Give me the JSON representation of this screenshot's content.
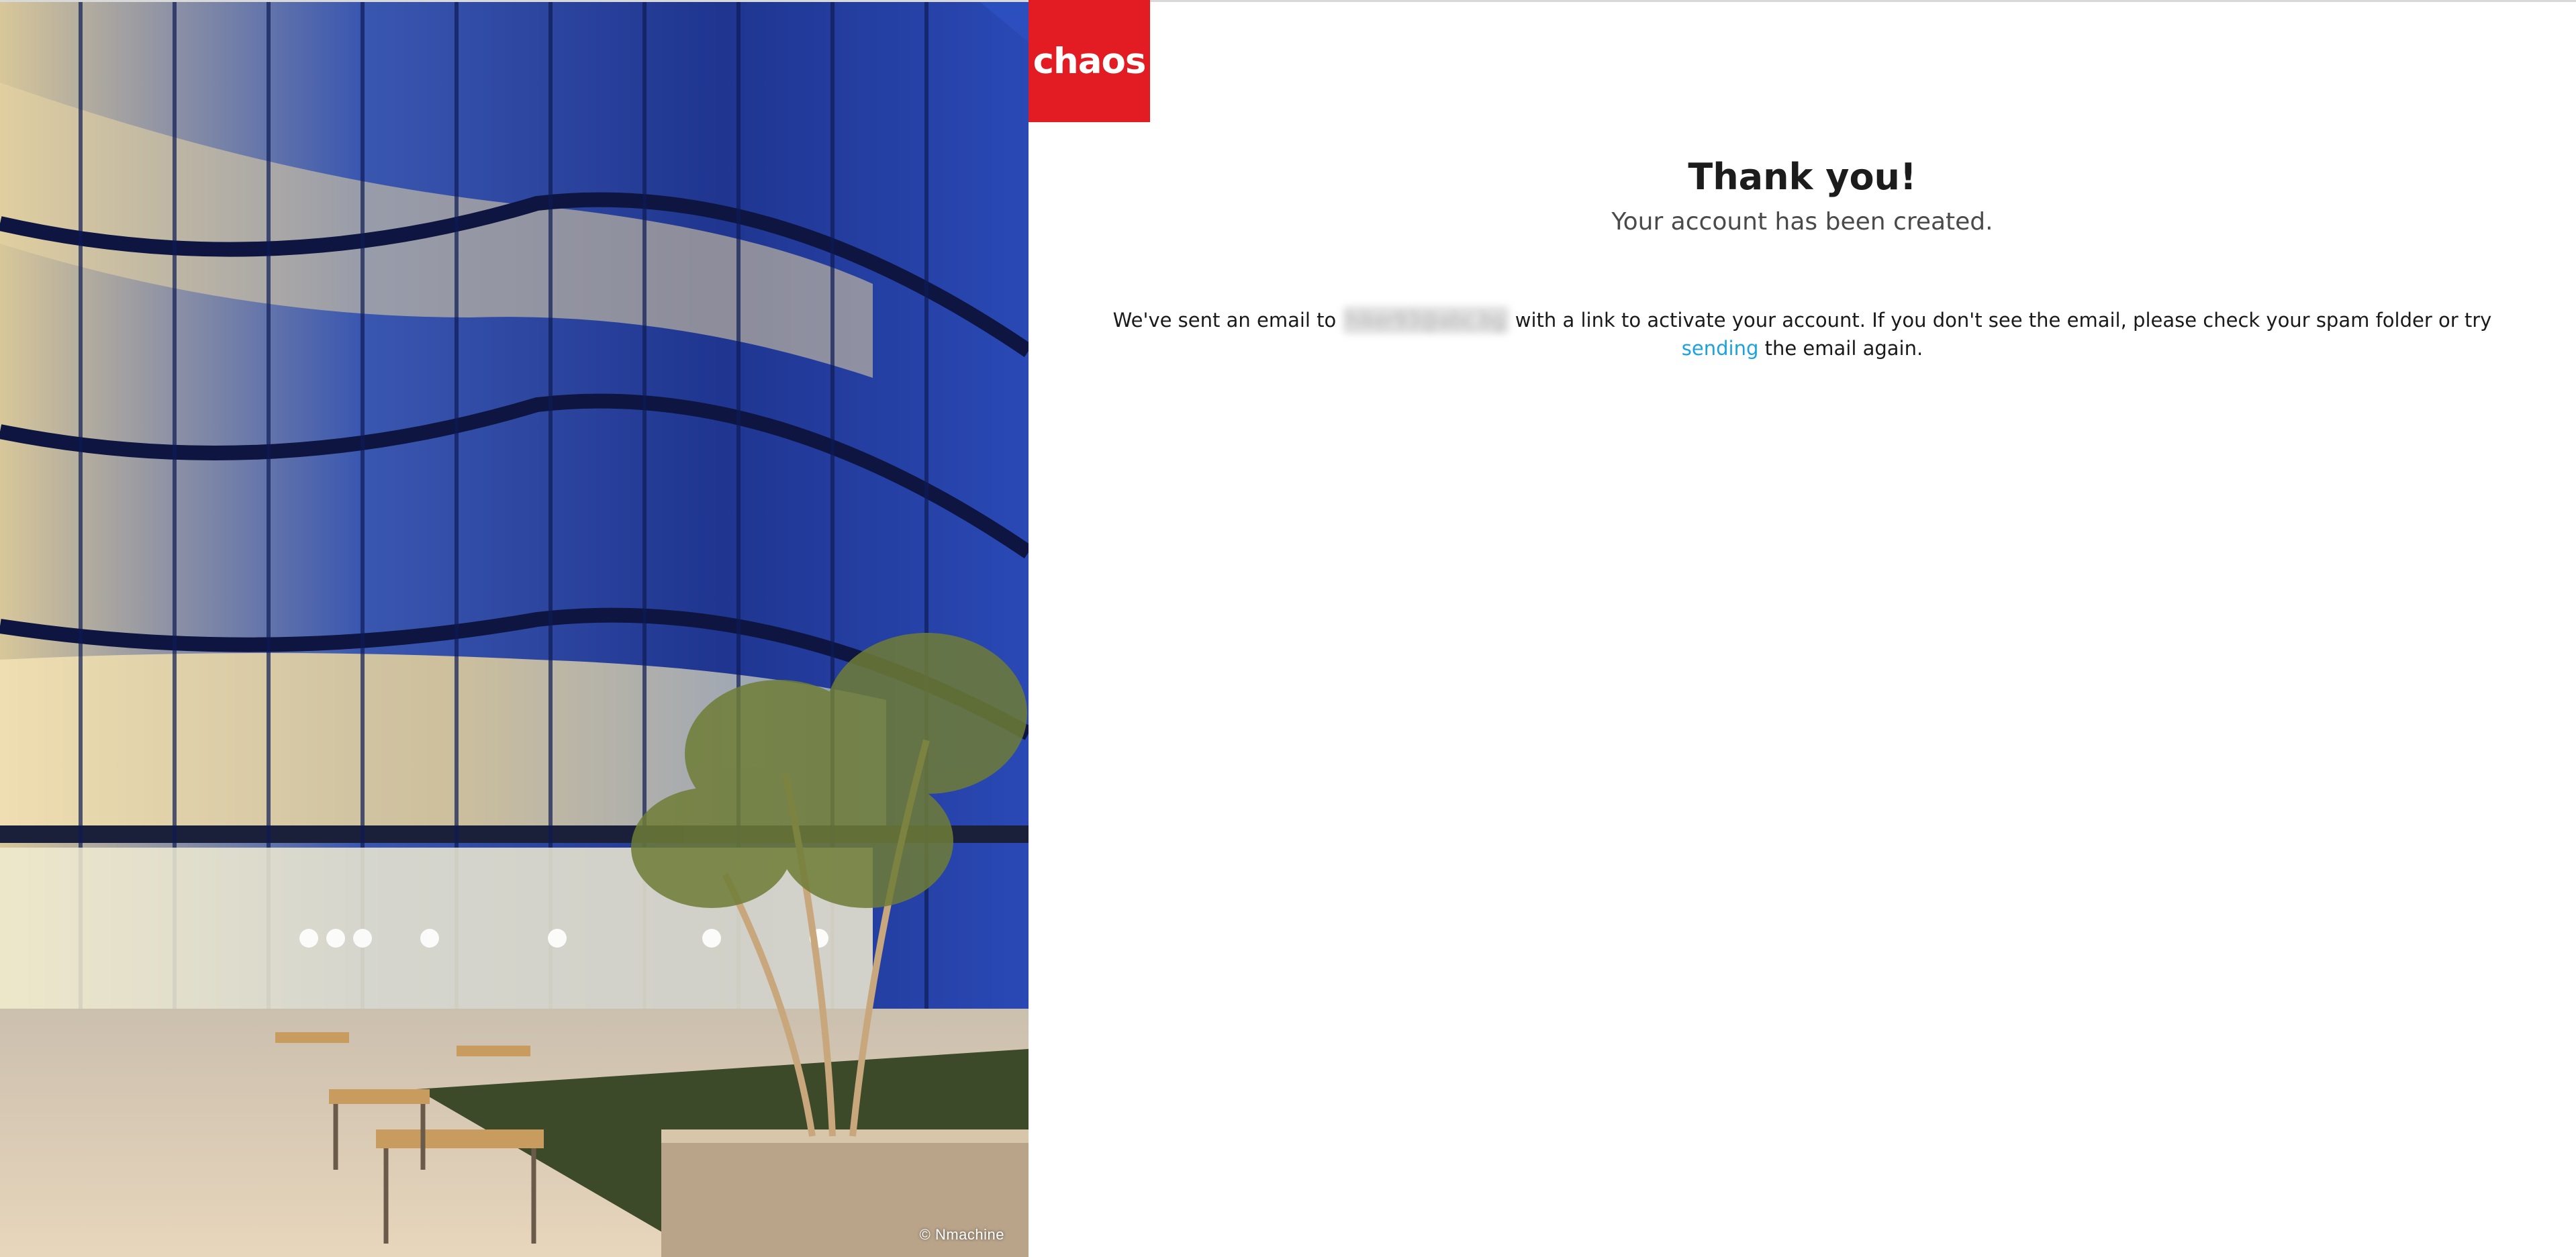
{
  "brand": {
    "logo_text": "chaos",
    "logo_color": "#e31b23"
  },
  "hero": {
    "credit": "© Nmachine"
  },
  "confirmation": {
    "title": "Thank you!",
    "subtitle": "Your account has been created.",
    "message_before": "We've sent an email to ",
    "email": "hiker93@abc.bg",
    "message_middle": " with a link to activate your account. If you don't see the email, please check your spam folder or try ",
    "resend_link": "sending",
    "message_after": " the email again."
  },
  "colors": {
    "link": "#1aa3df",
    "title": "#1c1c1c",
    "subtitle": "#4a4a4a"
  }
}
